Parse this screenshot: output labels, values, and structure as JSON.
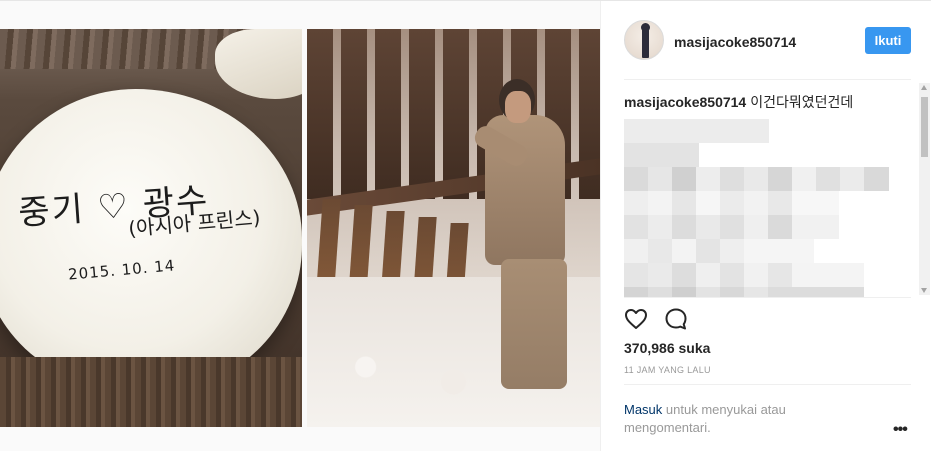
{
  "post": {
    "username": "masijacoke850714",
    "follow_label": "Ikuti",
    "caption_user": "masijacoke850714",
    "caption_text": "이건다뭐였던건데",
    "likes": "370,986 suka",
    "time": "11 JAM YANG LALU",
    "login_link": "Masuk",
    "login_text": " untuk menyukai atau mengomentari.",
    "more_label": "•••"
  },
  "media": {
    "left_photo": {
      "handwriting_line1": "중기 ♡ 광수",
      "handwriting_line2": "(아시아 프린스)",
      "handwriting_date": "2015. 10. 14"
    },
    "icons": {
      "like": "heart-outline-icon",
      "comment": "speech-bubble-icon"
    }
  },
  "colors": {
    "follow_button": "#3897f0",
    "link": "#003569",
    "muted_text": "#999999",
    "primary_text": "#262626",
    "border": "#efefef"
  }
}
